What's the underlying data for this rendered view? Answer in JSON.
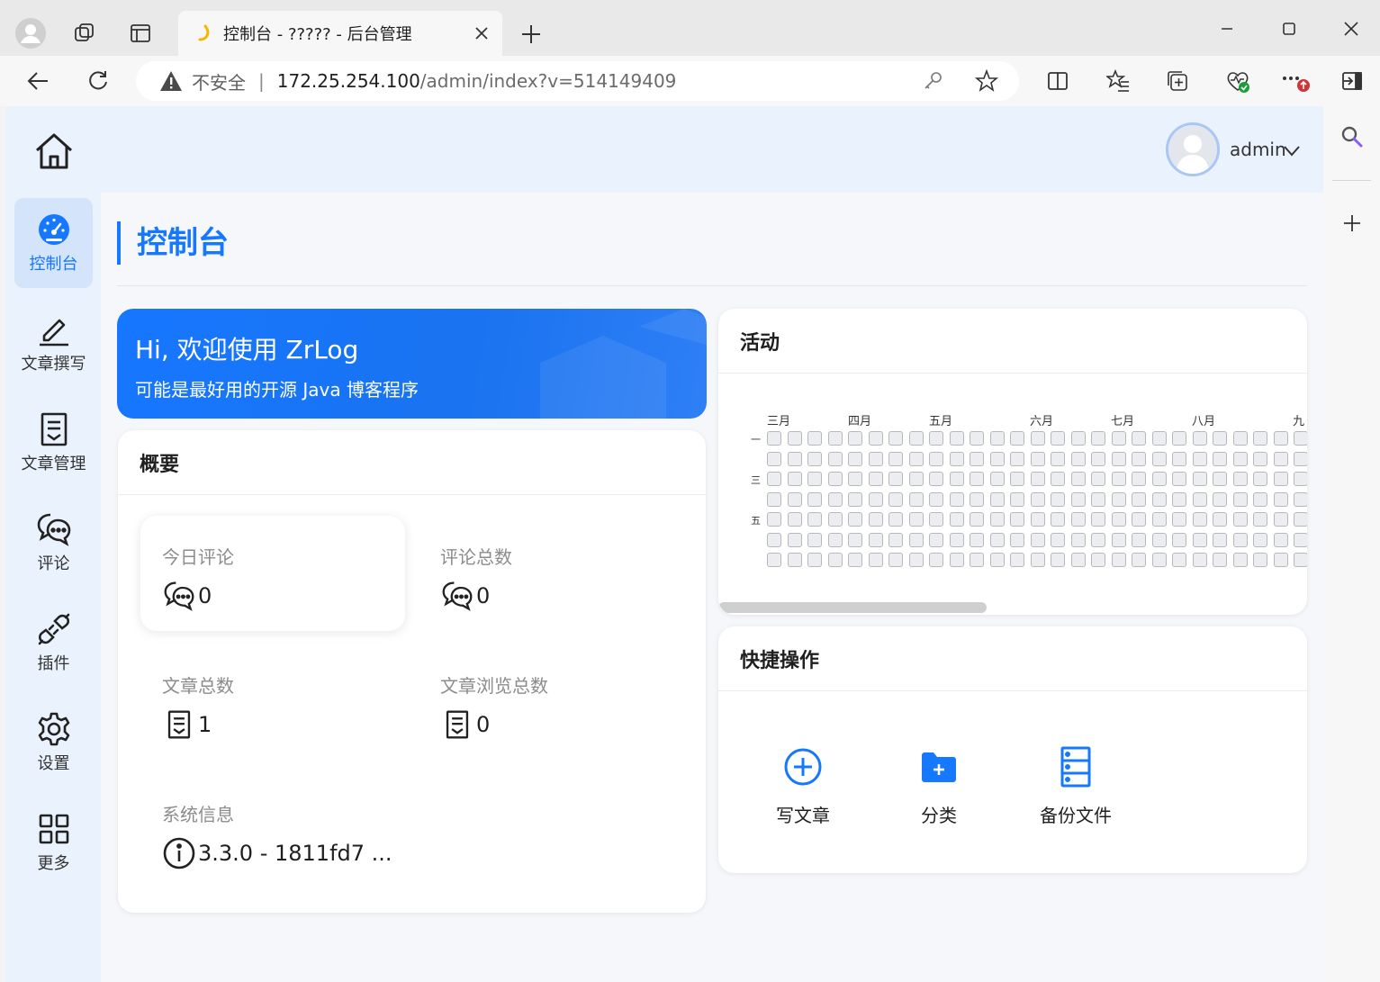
{
  "browser": {
    "tab_title": "控制台 - ????? - 后台管理",
    "address_warning": "不安全",
    "address_separator": "|",
    "address_host": "172.25.254.100",
    "address_path": "/admin/index?v=514149409"
  },
  "header": {
    "user_name": "admin"
  },
  "sidebar": {
    "items": [
      {
        "label": "控制台",
        "icon": "dashboard-icon",
        "active": true
      },
      {
        "label": "文章撰写",
        "icon": "pen-icon",
        "active": false
      },
      {
        "label": "文章管理",
        "icon": "document-icon",
        "active": false
      },
      {
        "label": "评论",
        "icon": "comment-icon",
        "active": false
      },
      {
        "label": "插件",
        "icon": "plug-icon",
        "active": false
      },
      {
        "label": "设置",
        "icon": "gear-icon",
        "active": false
      },
      {
        "label": "更多",
        "icon": "grid-icon",
        "active": false
      }
    ]
  },
  "main": {
    "page_title": "控制台",
    "banner": {
      "title": "Hi, 欢迎使用 ZrLog",
      "subtitle": "可能是最好用的开源 Java 博客程序"
    },
    "overview": {
      "title": "概要",
      "stats": [
        {
          "label": "今日评论",
          "value": "0",
          "icon": "comment-icon"
        },
        {
          "label": "评论总数",
          "value": "0",
          "icon": "comment-icon"
        },
        {
          "label": "文章总数",
          "value": "1",
          "icon": "document-icon"
        },
        {
          "label": "文章浏览总数",
          "value": "0",
          "icon": "document-icon"
        },
        {
          "label": "系统信息",
          "value": "3.3.0 - 1811fd7 ...",
          "icon": "info-icon"
        }
      ]
    },
    "activity": {
      "title": "活动",
      "months": [
        "三月",
        "四月",
        "五月",
        "六月",
        "七月",
        "八月",
        "九"
      ],
      "weekdays": [
        "一",
        "三",
        "五"
      ],
      "rows": 7,
      "columns": 27,
      "cell_color": "#ebedf0"
    },
    "quick": {
      "title": "快捷操作",
      "actions": [
        {
          "label": "写文章",
          "icon": "plus-circle-icon"
        },
        {
          "label": "分类",
          "icon": "folder-add-icon"
        },
        {
          "label": "备份文件",
          "icon": "database-icon"
        }
      ]
    }
  },
  "colors": {
    "accent": "#1677ff",
    "sidebar_bg": "#eaf2fd",
    "active_bg": "#d4e5fb"
  }
}
